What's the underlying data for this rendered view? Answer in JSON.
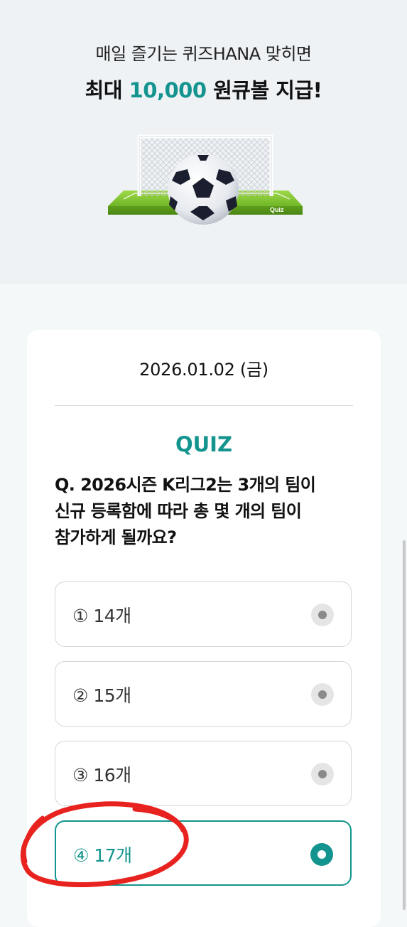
{
  "hero": {
    "subtitle": "매일 즐기는 퀴즈HANA 맞히면",
    "title_prefix": "최대 ",
    "title_accent": "10,000",
    "title_suffix": " 원큐볼 지급!",
    "illustration_icon": "soccer-goal-ball-illustration",
    "illustration_badge": "Quiz"
  },
  "quiz": {
    "date": "2026.01.02 (금)",
    "label": "QUIZ",
    "question_line1": "Q. 2026시즌 K리그2는 3개의 팀이",
    "question_line2": "신규 등록함에 따라 총 몇 개의 팀이",
    "question_line3": "참가하게 될까요?",
    "options": [
      {
        "label": "① 14개"
      },
      {
        "label": "② 15개"
      },
      {
        "label": "③ 16개"
      },
      {
        "label": "④ 17개"
      }
    ],
    "selected_index": 3
  },
  "colors": {
    "accent": "#13948e",
    "hero_bg": "#eef2f5",
    "page_bg": "#f4f8f8",
    "annotation": "#e8231f"
  }
}
